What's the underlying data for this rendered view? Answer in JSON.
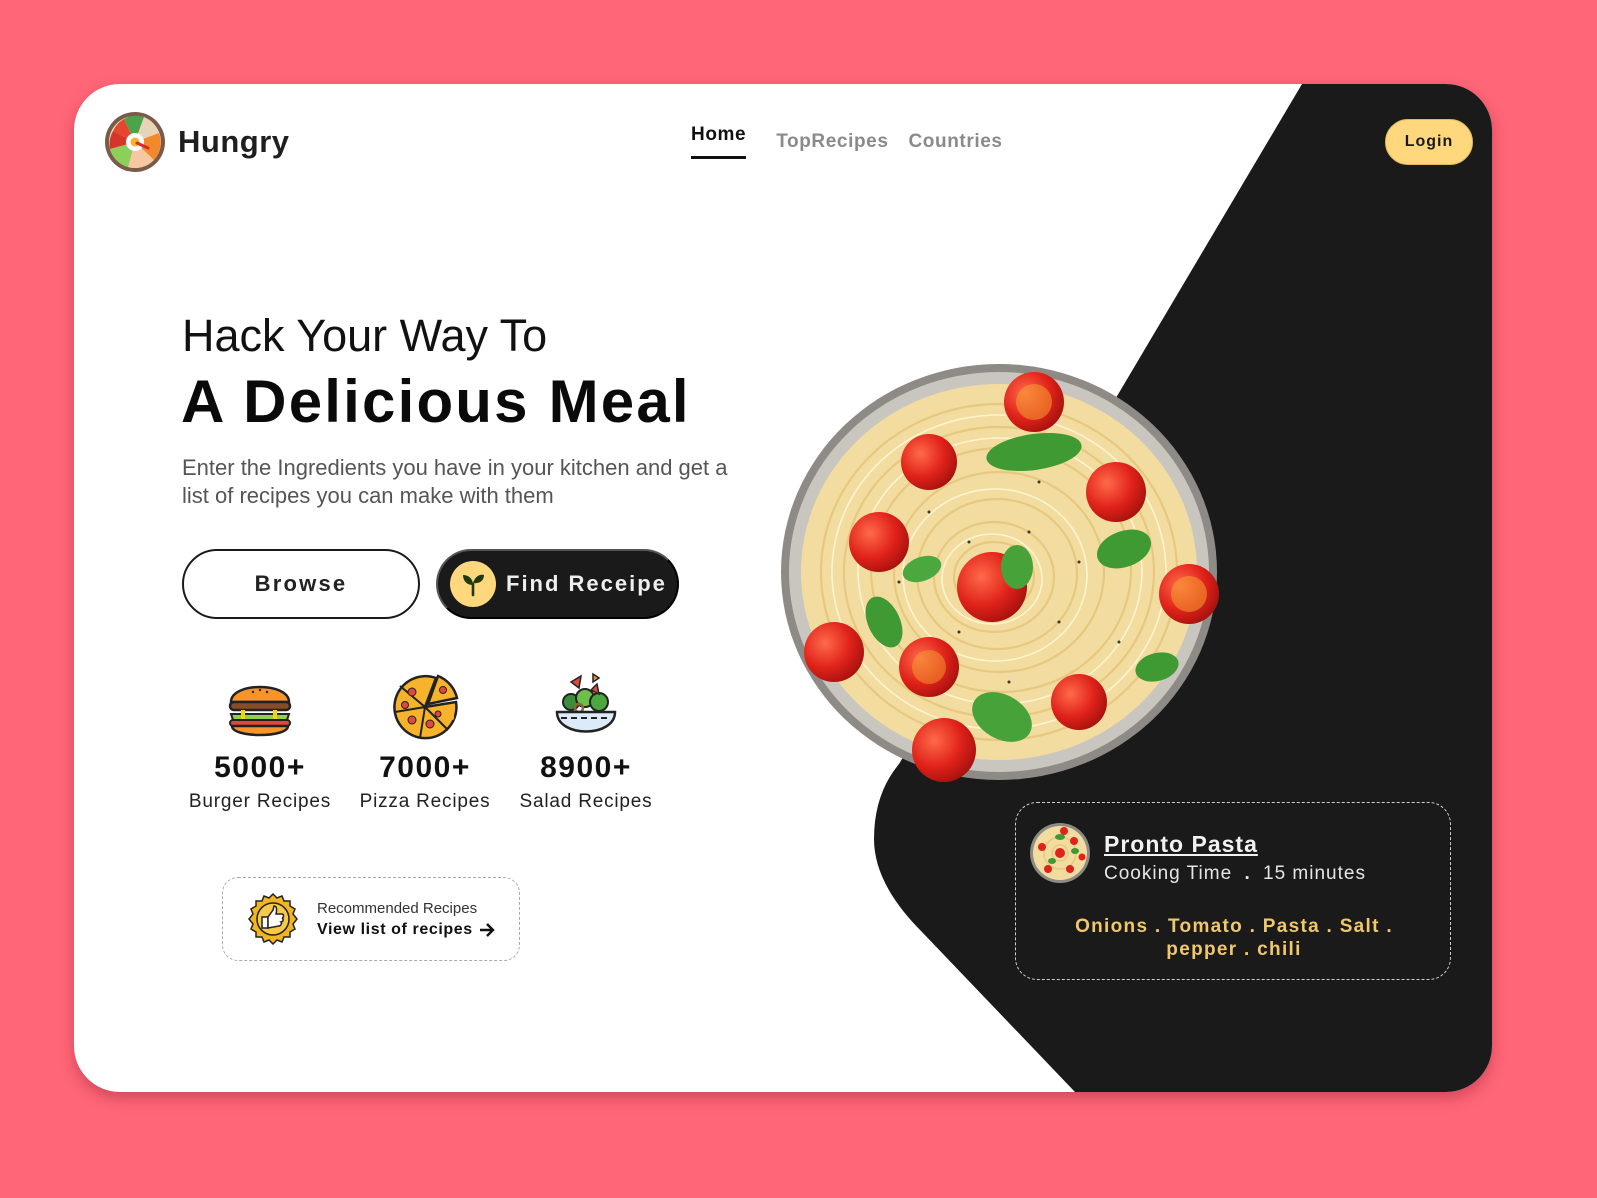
{
  "brand": {
    "name": "Hungry",
    "logo_icon": "bibimbap-bowl-icon"
  },
  "nav": {
    "items": [
      {
        "label": "Home",
        "active": true
      },
      {
        "label": "TopRecipes",
        "active": false
      },
      {
        "label": "Countries",
        "active": false
      }
    ],
    "login_label": "Login"
  },
  "hero": {
    "subtitle": "Hack Your Way To",
    "title": "A Delicious Meal",
    "description": "Enter the Ingredients you have in your kitchen and get a list of recipes you can make with them",
    "browse_label": "Browse",
    "find_label": "Find Receipe",
    "find_icon": "sprout-icon"
  },
  "stats": [
    {
      "icon": "burger-icon",
      "count": "5000+",
      "label": "Burger Recipes"
    },
    {
      "icon": "pizza-icon",
      "count": "7000+",
      "label": "Pizza Recipes"
    },
    {
      "icon": "salad-icon",
      "count": "8900+",
      "label": "Salad Recipes"
    }
  ],
  "recommended": {
    "icon": "thumbs-up-badge-icon",
    "title": "Recommended Recipes",
    "link_label": "View list of recipes",
    "link_icon": "arrow-right-icon"
  },
  "featured_image": "pasta-bowl-image",
  "recipe_card": {
    "name": "Pronto Pasta",
    "cooking_time_label": "Cooking Time",
    "separator": ".",
    "cooking_time": "15 minutes",
    "ingredients": "Onions . Tomato . Pasta . Salt . pepper . chili"
  },
  "colors": {
    "page_background": "#ff6677",
    "dark": "#1a1a1a",
    "accent_yellow": "#ffd77d",
    "ingredient_text": "#f0c86a"
  }
}
